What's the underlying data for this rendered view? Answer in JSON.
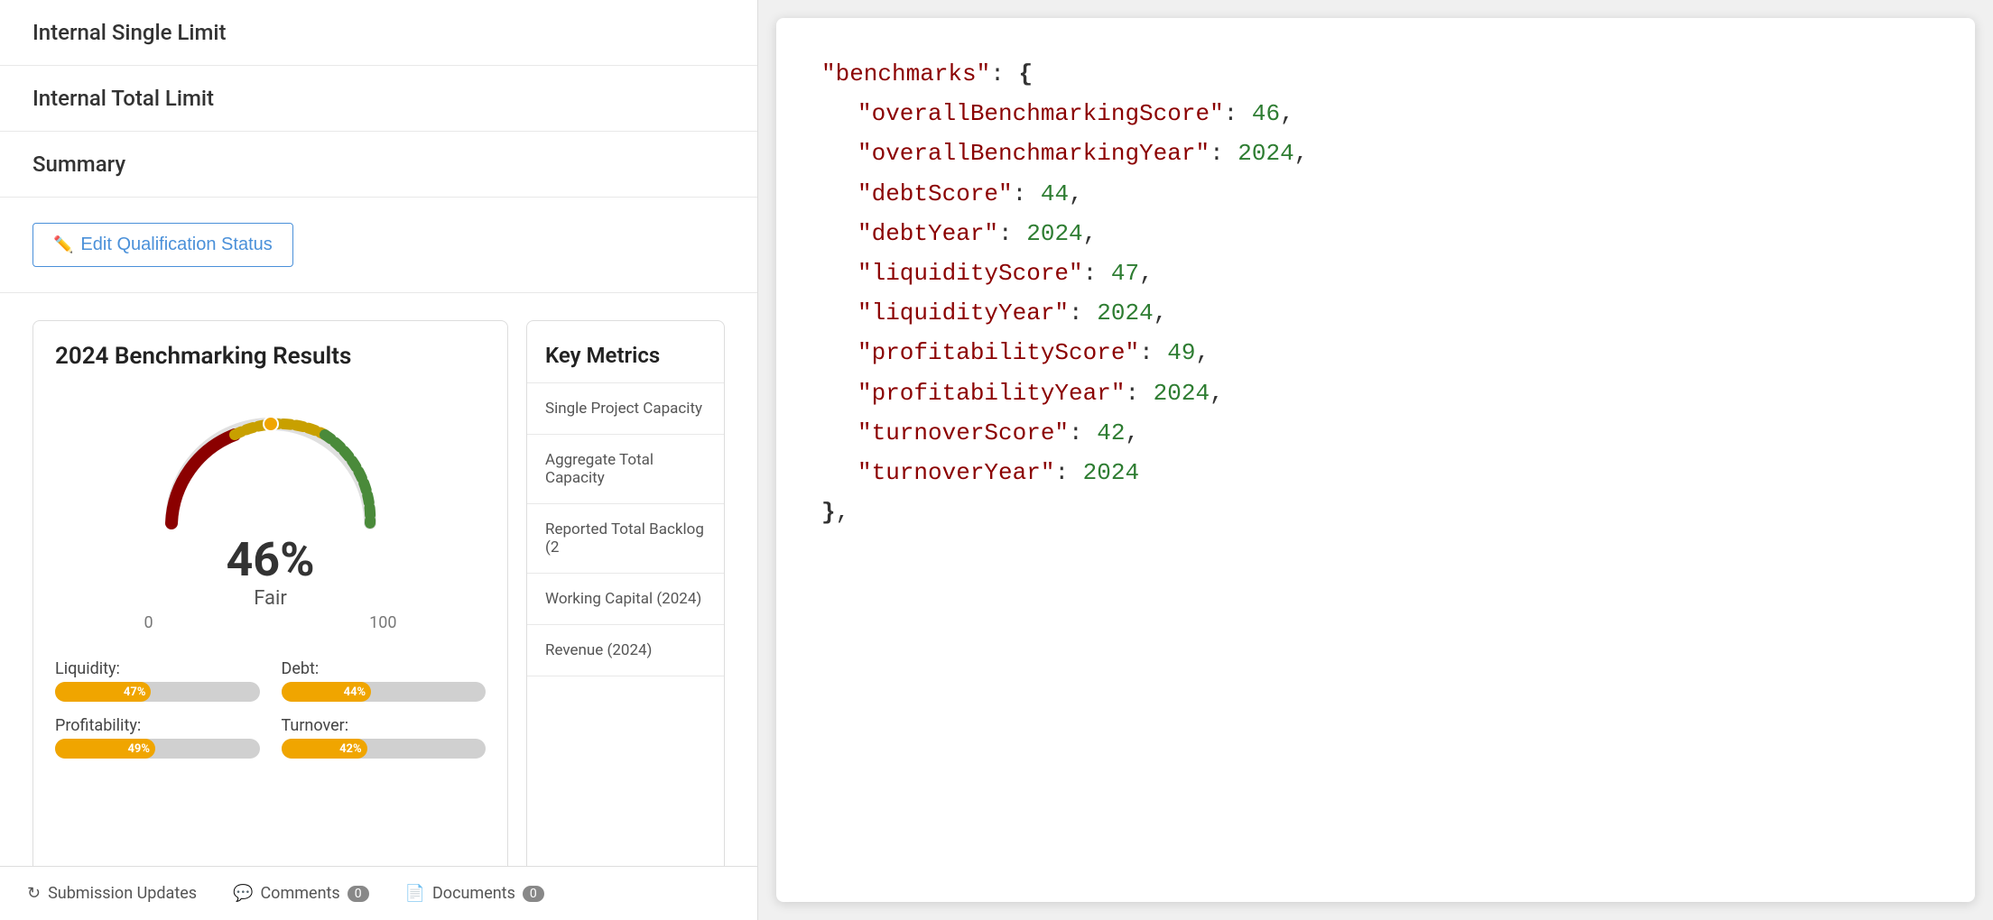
{
  "left_panel": {
    "info_rows": [
      {
        "label": "Internal Single Limit"
      },
      {
        "label": "Internal Total Limit"
      },
      {
        "label": "Summary"
      }
    ],
    "edit_button": "Edit Qualification Status",
    "benchmarking": {
      "title": "2024 Benchmarking Results",
      "score": "46%",
      "grade": "Fair",
      "range_min": "0",
      "range_max": "100",
      "metrics": [
        {
          "name": "Liquidity:",
          "value": 47,
          "percent": "47%"
        },
        {
          "name": "Debt:",
          "value": 44,
          "percent": "44%"
        },
        {
          "name": "Profitability:",
          "value": 49,
          "percent": "49%"
        },
        {
          "name": "Turnover:",
          "value": 42,
          "percent": "42%"
        }
      ]
    },
    "key_metrics": {
      "title": "Key Metrics",
      "items": [
        "Single Project Capacity",
        "Aggregate Total Capacity",
        "Reported Total Backlog (2",
        "Working Capital (2024)",
        "Revenue (2024)"
      ]
    },
    "bottom_bar": {
      "items": [
        {
          "label": "Submission Updates",
          "badge": null,
          "icon": "refresh"
        },
        {
          "label": "Comments",
          "badge": "0",
          "icon": "comment"
        },
        {
          "label": "Documents",
          "badge": "0",
          "icon": "document"
        }
      ]
    }
  },
  "right_panel": {
    "json_content": {
      "benchmarks": {
        "overallBenchmarkingScore": 46,
        "overallBenchmarkingYear": 2024,
        "debtScore": 44,
        "debtYear": 2024,
        "liquidityScore": 47,
        "liquidityYear": 2024,
        "profitabilityScore": 49,
        "profitabilityYear": 2024,
        "turnoverScore": 42,
        "turnoverYear": 2024
      }
    }
  }
}
